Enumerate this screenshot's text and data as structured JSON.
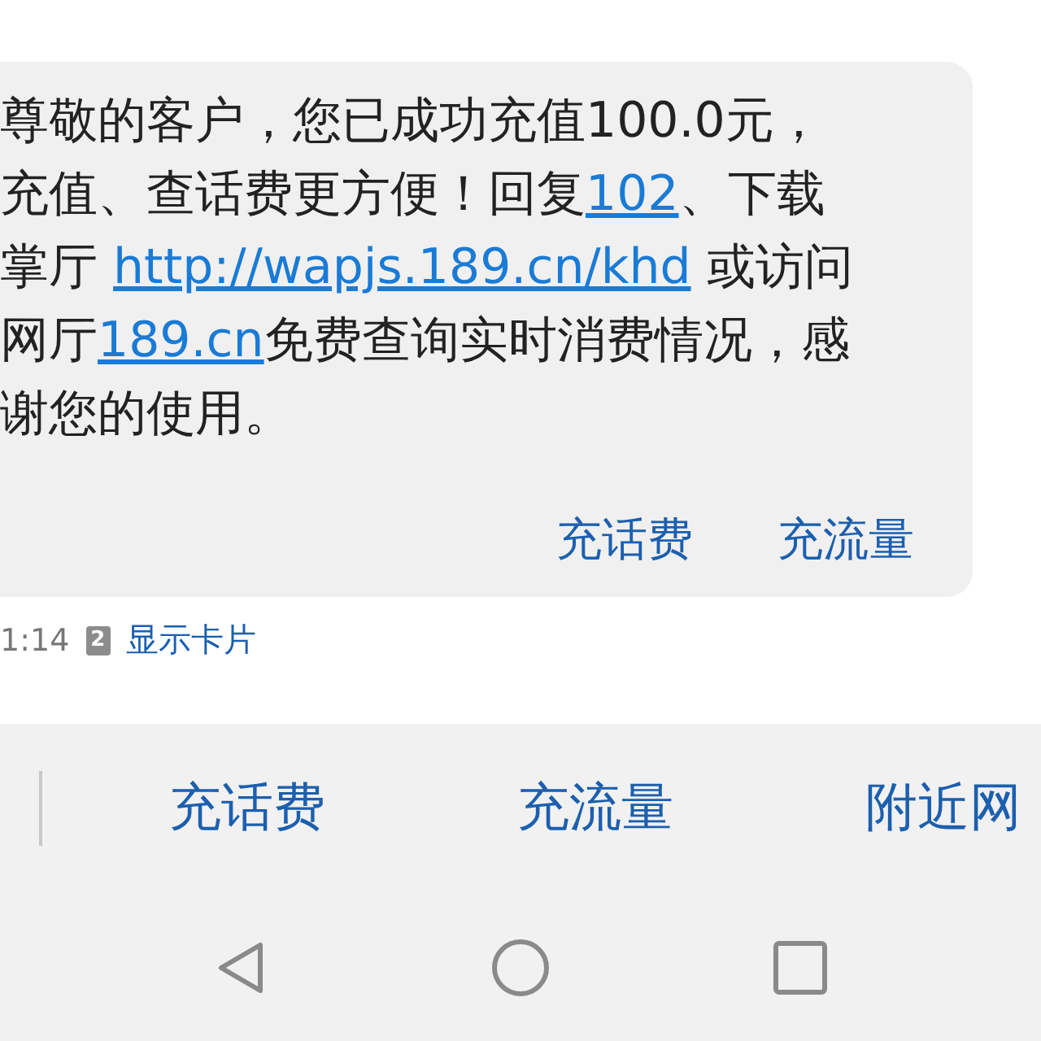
{
  "message": {
    "lines": [
      [
        {
          "kind": "text",
          "text": "尊敬的客户，您已成功充值100.0元，"
        }
      ],
      [
        {
          "kind": "text",
          "text": "充值、查话费更方便！回复"
        },
        {
          "kind": "link",
          "text": "102"
        },
        {
          "kind": "text",
          "text": "、下载"
        }
      ],
      [
        {
          "kind": "text",
          "text": "掌厅 "
        },
        {
          "kind": "link",
          "text": "http://wapjs.189.cn/khd"
        },
        {
          "kind": "text",
          "text": " 或访问"
        }
      ],
      [
        {
          "kind": "text",
          "text": "网厅"
        },
        {
          "kind": "link",
          "text": "189.cn"
        },
        {
          "kind": "text",
          "text": "免费查询实时消费情况，感"
        }
      ],
      [
        {
          "kind": "text",
          "text": "谢您的使用。"
        }
      ]
    ],
    "actions": [
      "充话费",
      "充流量"
    ],
    "time": "1:14",
    "sim": "2",
    "card_link": "显示卡片"
  },
  "quick_actions": [
    "充话费",
    "充流量",
    "附近网"
  ],
  "nav_buttons": [
    {
      "kind": "back"
    },
    {
      "kind": "home"
    },
    {
      "kind": "recent"
    }
  ]
}
